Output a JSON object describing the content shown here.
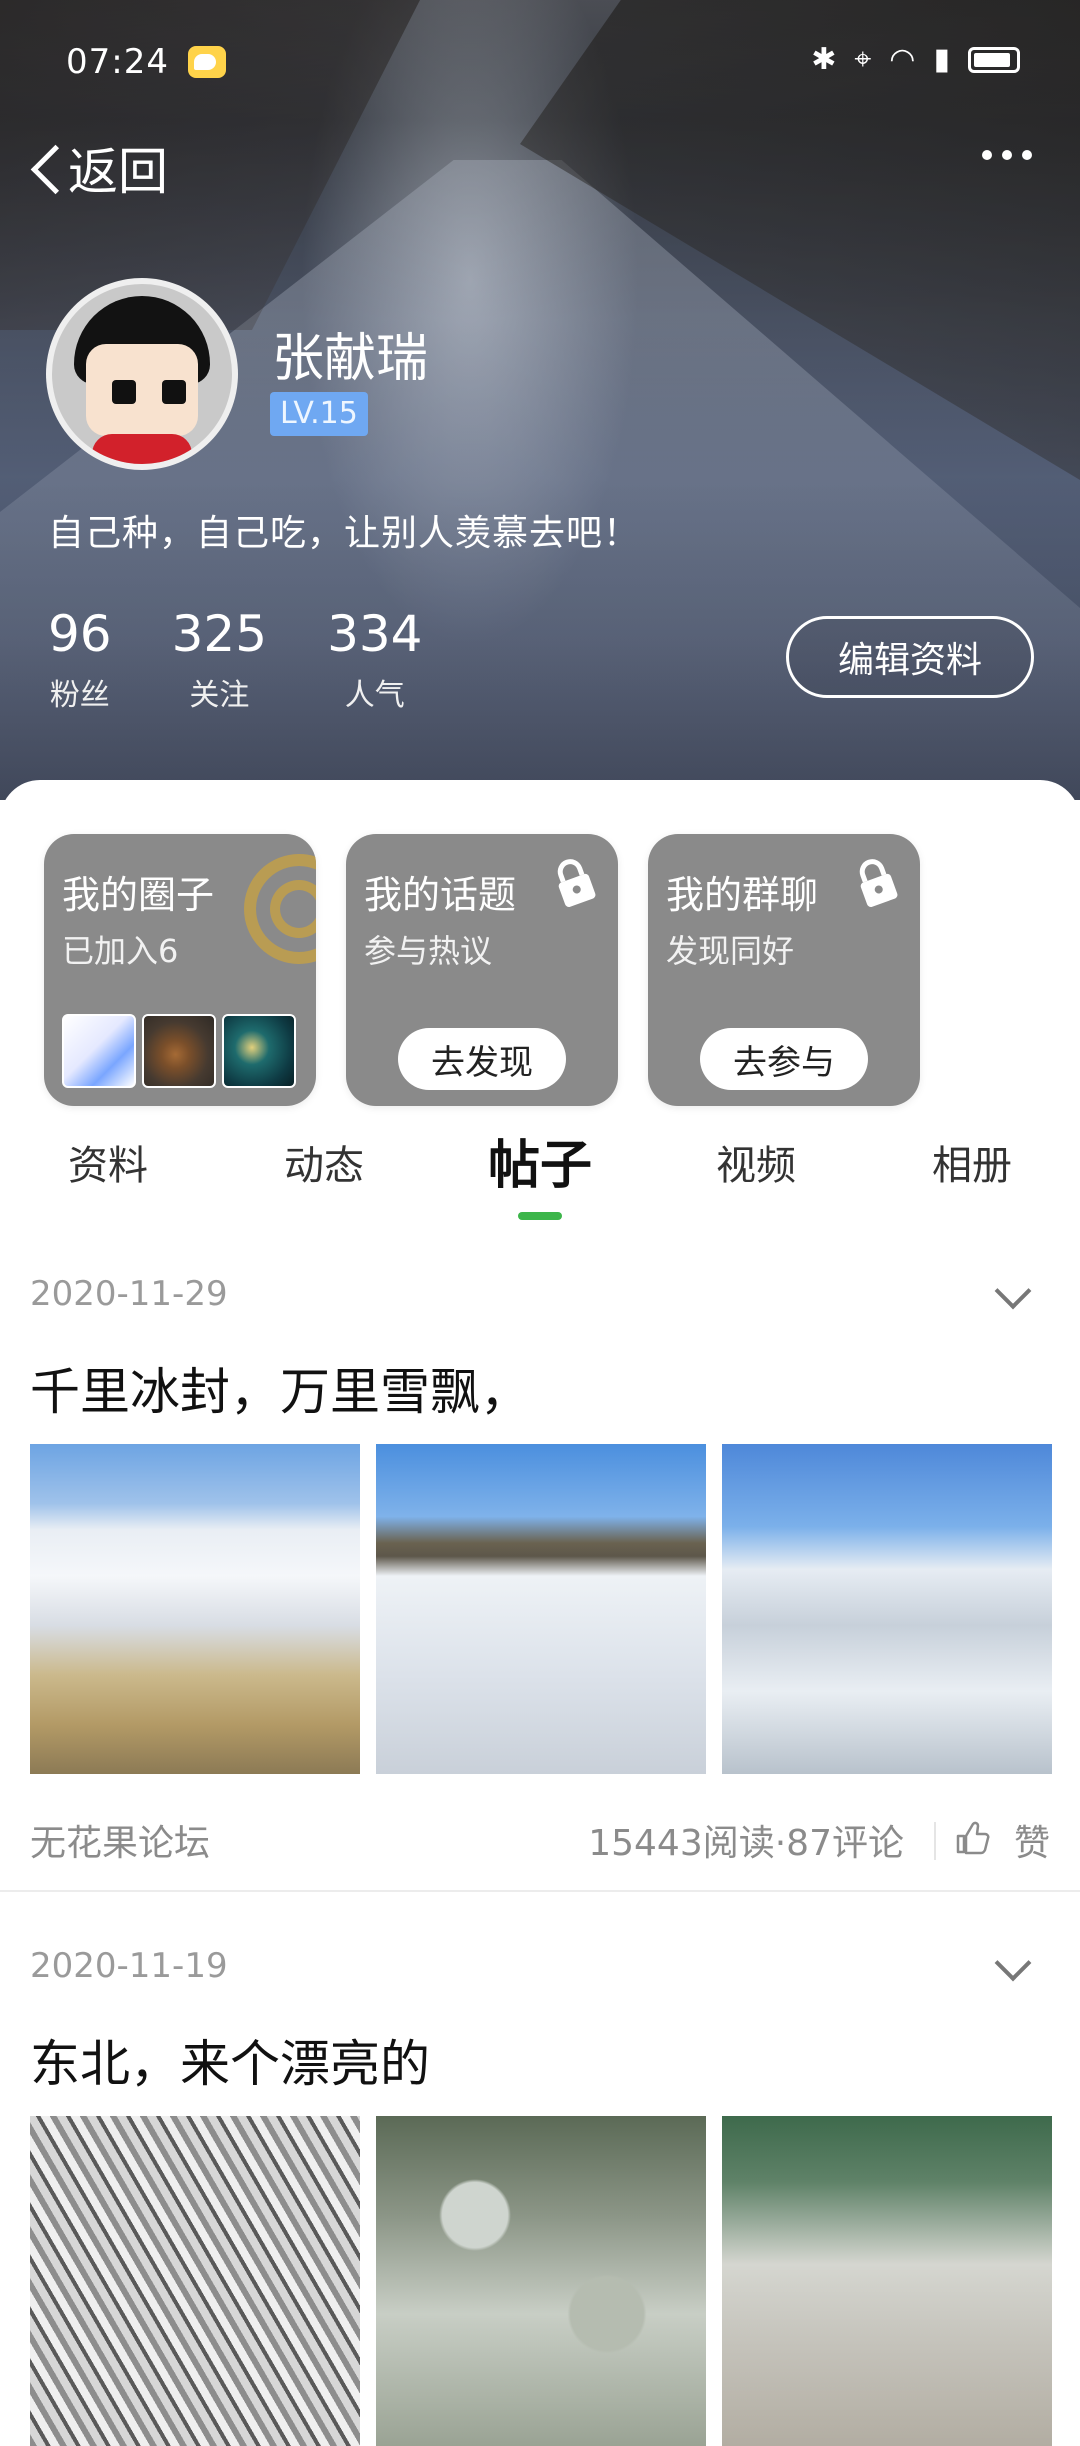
{
  "status_bar": {
    "time": "07:24",
    "icons": [
      "bluetooth-icon",
      "location-icon",
      "wifi-icon",
      "hd-signal-icon",
      "battery-icon"
    ]
  },
  "nav": {
    "back_label": "返回"
  },
  "profile": {
    "name": "张献瑞",
    "level": "LV.15",
    "bio": "自己种，自己吃，让别人羡慕去吧！",
    "stats": [
      {
        "value": "96",
        "label": "粉丝"
      },
      {
        "value": "325",
        "label": "关注"
      },
      {
        "value": "334",
        "label": "人气"
      }
    ],
    "edit_label": "编辑资料"
  },
  "cards": [
    {
      "title": "我的圈子",
      "subtitle": "已加入6",
      "button": ""
    },
    {
      "title": "我的话题",
      "subtitle": "参与热议",
      "button": "去发现"
    },
    {
      "title": "我的群聊",
      "subtitle": "发现同好",
      "button": "去参与"
    }
  ],
  "tabs": [
    {
      "label": "资料"
    },
    {
      "label": "动态"
    },
    {
      "label": "帖子",
      "active": true
    },
    {
      "label": "视频"
    },
    {
      "label": "相册"
    }
  ],
  "posts": [
    {
      "date": "2020-11-29",
      "title": "千里冰封，万里雪飘，",
      "source": "无花果论坛",
      "stats": "15443阅读·87评论",
      "like_label": "赞"
    },
    {
      "date": "2020-11-19",
      "title": "东北，来个漂亮的"
    }
  ],
  "colors": {
    "accent": "#3cb54a",
    "level_badge": "#6fa8f2",
    "card_bg": "#8a8a8a"
  }
}
